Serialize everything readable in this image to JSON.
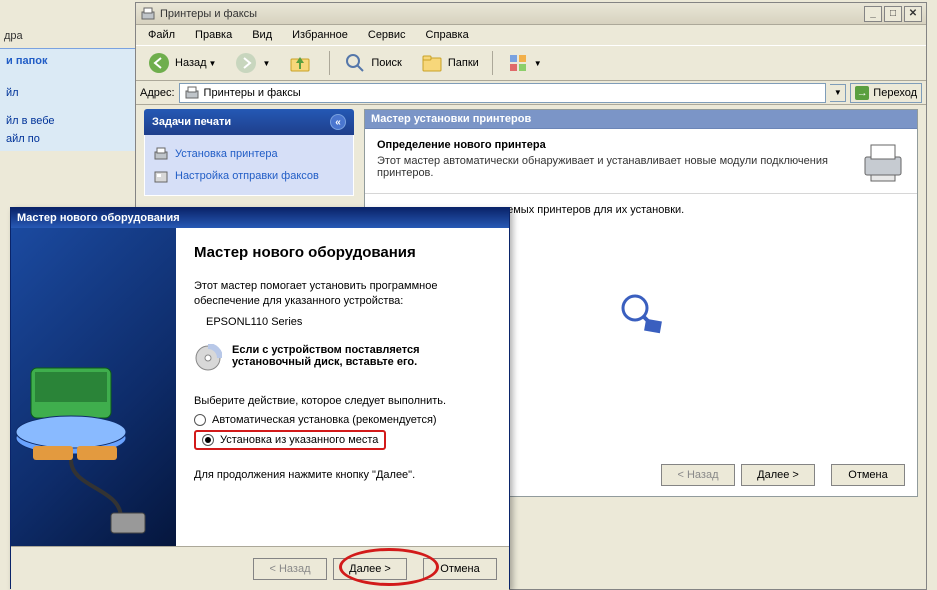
{
  "bg": {
    "header": "и папок",
    "items": [
      "йл",
      "йл в вебе",
      "айл по"
    ]
  },
  "printers": {
    "title": "Принтеры и факсы",
    "menus": [
      "Файл",
      "Правка",
      "Вид",
      "Избранное",
      "Сервис",
      "Справка"
    ],
    "toolbar": {
      "back": "Назад",
      "search": "Поиск",
      "folders": "Папки"
    },
    "address_label": "Адрес:",
    "address_value": "Принтеры и факсы",
    "go_label": "Переход",
    "tasks": {
      "header": "Задачи печати",
      "items": [
        "Установка принтера",
        "Настройка отправки факсов"
      ]
    },
    "wizard": {
      "title": "Мастер установки принтеров",
      "head_bold": "Определение нового принтера",
      "head_sub": "Этот мастер автоматически обнаруживает и устанавливает новые модули подключения принтеров.",
      "body_text": "ск новых самонастраиваемых принтеров для их установки.",
      "buttons": {
        "back": "< Назад",
        "next": "Далее >",
        "cancel": "Отмена"
      }
    }
  },
  "hw": {
    "title": "Мастер нового оборудования",
    "heading": "Мастер нового оборудования",
    "help1": "Этот мастер помогает установить программное обеспечение для указанного устройства:",
    "device": "EPSONL110 Series",
    "cd_bold": "Если с устройством поставляется установочный диск, вставьте его.",
    "choose": "Выберите действие, которое следует выполнить.",
    "opt_auto": "Автоматическая установка (рекомендуется)",
    "opt_manual": "Установка из указанного места",
    "continue": "Для продолжения нажмите кнопку \"Далее\".",
    "buttons": {
      "back": "< Назад",
      "next": "Далее >",
      "cancel": "Отмена"
    }
  },
  "fragment_top": "дра"
}
